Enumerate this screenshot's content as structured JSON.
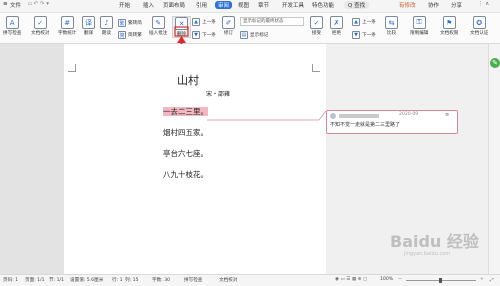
{
  "titlebar": {
    "menu_file": "文件",
    "tabs": [
      "开始",
      "插入",
      "页面布局",
      "引用",
      "审阅",
      "视图",
      "章节",
      "开发工具",
      "特色功能"
    ],
    "active_tab_index": 4,
    "search_label": "Q 查找",
    "right": [
      "有修改",
      "协作",
      "分享"
    ]
  },
  "ribbon": {
    "left_buttons": [
      "拼写检查",
      "文档校对",
      "字数统计",
      "翻译",
      "朗读"
    ],
    "mid_small": [
      "繁转简",
      "简转繁"
    ],
    "insert_comment": "插入批注",
    "delete_comment": "删除",
    "prev_label": "上一条",
    "next_label": "下一条",
    "revise_label": "修订",
    "display_select": "显示标记的最终状态",
    "show_markup": "显示标记",
    "accept_label": "接受",
    "reject_label": "拒绝",
    "prev2_label": "上一条",
    "next2_label": "下一条",
    "compare_label": "比较",
    "restrict_label": "限制编辑",
    "doc_permission": "文档权限",
    "doc_cert": "文档认证"
  },
  "document": {
    "title": "山村",
    "author": "宋・邵雍",
    "lines": [
      "一去二三里。",
      "烟村四五家。",
      "亭台六七座。",
      "八九十枝花。"
    ]
  },
  "comment": {
    "date": "2020-09",
    "text": "不知不觉一走就是第二三里路了"
  },
  "statusbar": {
    "page_num": "页码: 1",
    "pages": "页面: 1/1",
    "section": "节: 1/1",
    "setting": "设置值: 5.6厘米",
    "row": "行: 1",
    "col": "列: 15",
    "wordcount": "字数: 30",
    "spellcheck": "拼写检查",
    "doccheck": "文档校对",
    "zoom": "100%"
  },
  "watermark": "Baidu 经验",
  "watermark_url": "jingyan.baidu.com"
}
